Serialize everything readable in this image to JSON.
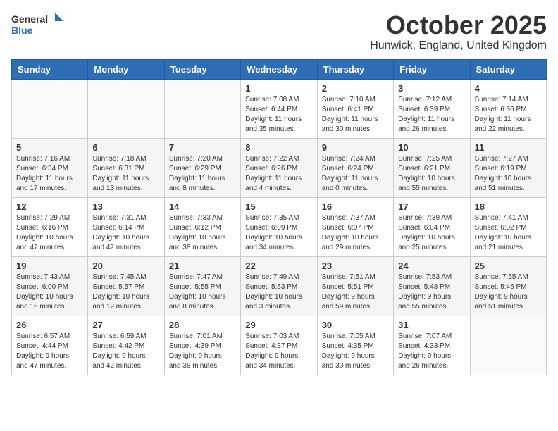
{
  "header": {
    "logo_general": "General",
    "logo_blue": "Blue",
    "month": "October 2025",
    "location": "Hunwick, England, United Kingdom"
  },
  "days_of_week": [
    "Sunday",
    "Monday",
    "Tuesday",
    "Wednesday",
    "Thursday",
    "Friday",
    "Saturday"
  ],
  "weeks": [
    [
      {
        "day": "",
        "info": ""
      },
      {
        "day": "",
        "info": ""
      },
      {
        "day": "",
        "info": ""
      },
      {
        "day": "1",
        "info": "Sunrise: 7:08 AM\nSunset: 6:44 PM\nDaylight: 11 hours\nand 35 minutes."
      },
      {
        "day": "2",
        "info": "Sunrise: 7:10 AM\nSunset: 6:41 PM\nDaylight: 11 hours\nand 30 minutes."
      },
      {
        "day": "3",
        "info": "Sunrise: 7:12 AM\nSunset: 6:39 PM\nDaylight: 11 hours\nand 26 minutes."
      },
      {
        "day": "4",
        "info": "Sunrise: 7:14 AM\nSunset: 6:36 PM\nDaylight: 11 hours\nand 22 minutes."
      }
    ],
    [
      {
        "day": "5",
        "info": "Sunrise: 7:16 AM\nSunset: 6:34 PM\nDaylight: 11 hours\nand 17 minutes."
      },
      {
        "day": "6",
        "info": "Sunrise: 7:18 AM\nSunset: 6:31 PM\nDaylight: 11 hours\nand 13 minutes."
      },
      {
        "day": "7",
        "info": "Sunrise: 7:20 AM\nSunset: 6:29 PM\nDaylight: 11 hours\nand 8 minutes."
      },
      {
        "day": "8",
        "info": "Sunrise: 7:22 AM\nSunset: 6:26 PM\nDaylight: 11 hours\nand 4 minutes."
      },
      {
        "day": "9",
        "info": "Sunrise: 7:24 AM\nSunset: 6:24 PM\nDaylight: 11 hours\nand 0 minutes."
      },
      {
        "day": "10",
        "info": "Sunrise: 7:25 AM\nSunset: 6:21 PM\nDaylight: 10 hours\nand 55 minutes."
      },
      {
        "day": "11",
        "info": "Sunrise: 7:27 AM\nSunset: 6:19 PM\nDaylight: 10 hours\nand 51 minutes."
      }
    ],
    [
      {
        "day": "12",
        "info": "Sunrise: 7:29 AM\nSunset: 6:16 PM\nDaylight: 10 hours\nand 47 minutes."
      },
      {
        "day": "13",
        "info": "Sunrise: 7:31 AM\nSunset: 6:14 PM\nDaylight: 10 hours\nand 42 minutes."
      },
      {
        "day": "14",
        "info": "Sunrise: 7:33 AM\nSunset: 6:12 PM\nDaylight: 10 hours\nand 38 minutes."
      },
      {
        "day": "15",
        "info": "Sunrise: 7:35 AM\nSunset: 6:09 PM\nDaylight: 10 hours\nand 34 minutes."
      },
      {
        "day": "16",
        "info": "Sunrise: 7:37 AM\nSunset: 6:07 PM\nDaylight: 10 hours\nand 29 minutes."
      },
      {
        "day": "17",
        "info": "Sunrise: 7:39 AM\nSunset: 6:04 PM\nDaylight: 10 hours\nand 25 minutes."
      },
      {
        "day": "18",
        "info": "Sunrise: 7:41 AM\nSunset: 6:02 PM\nDaylight: 10 hours\nand 21 minutes."
      }
    ],
    [
      {
        "day": "19",
        "info": "Sunrise: 7:43 AM\nSunset: 6:00 PM\nDaylight: 10 hours\nand 16 minutes."
      },
      {
        "day": "20",
        "info": "Sunrise: 7:45 AM\nSunset: 5:57 PM\nDaylight: 10 hours\nand 12 minutes."
      },
      {
        "day": "21",
        "info": "Sunrise: 7:47 AM\nSunset: 5:55 PM\nDaylight: 10 hours\nand 8 minutes."
      },
      {
        "day": "22",
        "info": "Sunrise: 7:49 AM\nSunset: 5:53 PM\nDaylight: 10 hours\nand 3 minutes."
      },
      {
        "day": "23",
        "info": "Sunrise: 7:51 AM\nSunset: 5:51 PM\nDaylight: 9 hours\nand 59 minutes."
      },
      {
        "day": "24",
        "info": "Sunrise: 7:53 AM\nSunset: 5:48 PM\nDaylight: 9 hours\nand 55 minutes."
      },
      {
        "day": "25",
        "info": "Sunrise: 7:55 AM\nSunset: 5:46 PM\nDaylight: 9 hours\nand 51 minutes."
      }
    ],
    [
      {
        "day": "26",
        "info": "Sunrise: 6:57 AM\nSunset: 4:44 PM\nDaylight: 9 hours\nand 47 minutes."
      },
      {
        "day": "27",
        "info": "Sunrise: 6:59 AM\nSunset: 4:42 PM\nDaylight: 9 hours\nand 42 minutes."
      },
      {
        "day": "28",
        "info": "Sunrise: 7:01 AM\nSunset: 4:39 PM\nDaylight: 9 hours\nand 38 minutes."
      },
      {
        "day": "29",
        "info": "Sunrise: 7:03 AM\nSunset: 4:37 PM\nDaylight: 9 hours\nand 34 minutes."
      },
      {
        "day": "30",
        "info": "Sunrise: 7:05 AM\nSunset: 4:35 PM\nDaylight: 9 hours\nand 30 minutes."
      },
      {
        "day": "31",
        "info": "Sunrise: 7:07 AM\nSunset: 4:33 PM\nDaylight: 9 hours\nand 26 minutes."
      },
      {
        "day": "",
        "info": ""
      }
    ]
  ]
}
